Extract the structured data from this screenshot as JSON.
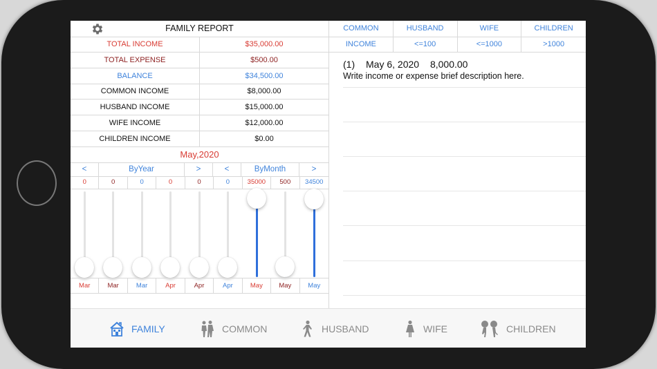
{
  "header": {
    "title": "FAMILY REPORT",
    "settings_icon": "gear-icon"
  },
  "summary": [
    {
      "label": "TOTAL INCOME",
      "value": "$35,000.00",
      "tone": "red"
    },
    {
      "label": "TOTAL EXPENSE",
      "value": "$500.00",
      "tone": "maroon"
    },
    {
      "label": "BALANCE",
      "value": "$34,500.00",
      "tone": "blue"
    },
    {
      "label": "COMMON INCOME",
      "value": "$8,000.00",
      "tone": "black"
    },
    {
      "label": "HUSBAND INCOME",
      "value": "$15,000.00",
      "tone": "black"
    },
    {
      "label": "WIFE INCOME",
      "value": "$12,000.00",
      "tone": "black"
    },
    {
      "label": "CHILDREN INCOME",
      "value": "$0.00",
      "tone": "black"
    }
  ],
  "period": "May,2020",
  "nav": {
    "prev": "<",
    "by_year": "ByYear",
    "next": ">",
    "by_month": "ByMonth"
  },
  "bars": [
    {
      "value": "0",
      "month": "Mar",
      "tone": "red",
      "level": 0
    },
    {
      "value": "0",
      "month": "Mar",
      "tone": "maroon",
      "level": 0
    },
    {
      "value": "0",
      "month": "Mar",
      "tone": "blue",
      "level": 0
    },
    {
      "value": "0",
      "month": "Apr",
      "tone": "red",
      "level": 0
    },
    {
      "value": "0",
      "month": "Apr",
      "tone": "maroon",
      "level": 0
    },
    {
      "value": "0",
      "month": "Apr",
      "tone": "blue",
      "level": 0
    },
    {
      "value": "35000",
      "month": "May",
      "tone": "red",
      "level": 1
    },
    {
      "value": "500",
      "month": "May",
      "tone": "maroon",
      "level": 0.0143
    },
    {
      "value": "34500",
      "month": "May",
      "tone": "blue",
      "level": 0.9857
    }
  ],
  "category_tabs": [
    "COMMON",
    "HUSBAND",
    "WIFE",
    "CHILDREN"
  ],
  "filter_tabs": [
    "INCOME",
    "<=100",
    "<=1000",
    ">1000"
  ],
  "entries": [
    {
      "index": "(1)",
      "date": "May 6, 2020",
      "amount": "8,000.00",
      "description": "Write income or expense brief description here."
    }
  ],
  "tabbar": [
    {
      "label": "FAMILY",
      "icon": "house-icon",
      "active": true
    },
    {
      "label": "COMMON",
      "icon": "couple-icon",
      "active": false
    },
    {
      "label": "HUSBAND",
      "icon": "man-walking-icon",
      "active": false
    },
    {
      "label": "WIFE",
      "icon": "woman-icon",
      "active": false
    },
    {
      "label": "CHILDREN",
      "icon": "children-icon",
      "active": false
    }
  ],
  "colors": {
    "red": "#d83b33",
    "maroon": "#8e2323",
    "blue": "#3f83db",
    "slider_fill": "#2f6fdb"
  }
}
